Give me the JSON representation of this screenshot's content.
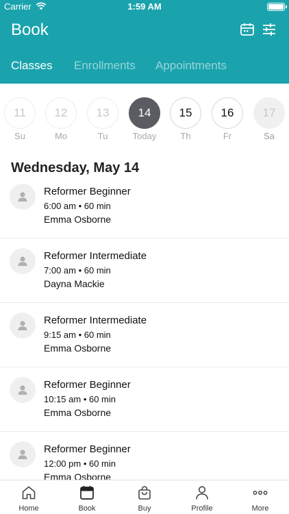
{
  "status_bar": {
    "carrier": "Carrier",
    "time": "1:59 AM"
  },
  "header": {
    "title": "Book",
    "tabs": [
      {
        "label": "Classes"
      },
      {
        "label": "Enrollments"
      },
      {
        "label": "Appointments"
      }
    ],
    "accent_color": "#1aa3ad"
  },
  "days": [
    {
      "number": "11",
      "label": "Su"
    },
    {
      "number": "12",
      "label": "Mo"
    },
    {
      "number": "13",
      "label": "Tu"
    },
    {
      "number": "14",
      "label": "Today"
    },
    {
      "number": "15",
      "label": "Th"
    },
    {
      "number": "16",
      "label": "Fr"
    },
    {
      "number": "17",
      "label": "Sa"
    }
  ],
  "date_heading": "Wednesday, May 14",
  "classes": [
    {
      "name": "Reformer Beginner",
      "time": "6:00 am • 60 min",
      "instructor": "Emma Osborne"
    },
    {
      "name": "Reformer Intermediate",
      "time": "7:00 am • 60 min",
      "instructor": "Dayna Mackie"
    },
    {
      "name": "Reformer Intermediate",
      "time": "9:15 am • 60 min",
      "instructor": "Emma Osborne"
    },
    {
      "name": "Reformer Beginner",
      "time": "10:15 am • 60 min",
      "instructor": "Emma Osborne"
    },
    {
      "name": "Reformer Beginner",
      "time": "12:00 pm • 60 min",
      "instructor": "Emma Osborne"
    }
  ],
  "tab_bar": [
    {
      "label": "Home",
      "icon": "home-icon"
    },
    {
      "label": "Book",
      "icon": "calendar-icon"
    },
    {
      "label": "Buy",
      "icon": "shopping-bag-icon"
    },
    {
      "label": "Profile",
      "icon": "person-icon"
    },
    {
      "label": "More",
      "icon": "more-dots-icon"
    }
  ]
}
